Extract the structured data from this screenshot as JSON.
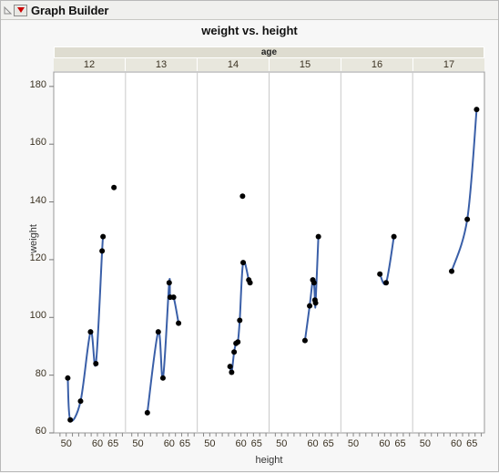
{
  "window": {
    "title": "Graph Builder",
    "disclosure_icon": "triangle-collapse-icon",
    "menu_icon": "red-triangle-menu-icon"
  },
  "chart_data": {
    "type": "scatter",
    "title": "weight vs. height",
    "xlabel": "height",
    "ylabel": "weight",
    "xlim": [
      46,
      69
    ],
    "ylim": [
      60,
      185
    ],
    "ytick_values": [
      60,
      80,
      100,
      120,
      140,
      160,
      180
    ],
    "xtick_values": [
      50,
      60,
      65
    ],
    "xtick_labels": [
      "50",
      "60",
      "65"
    ],
    "grid": false,
    "legend": "none",
    "facet_title": "age",
    "facet_values": [
      "12",
      "13",
      "14",
      "15",
      "16",
      "17"
    ],
    "point_color": "#000000",
    "line_color": "#3a5fa8",
    "panels": [
      {
        "facet": "12",
        "points": [
          {
            "x": 50.5,
            "y": 79
          },
          {
            "x": 51.3,
            "y": 64.5
          },
          {
            "x": 54.6,
            "y": 71
          },
          {
            "x": 57.8,
            "y": 95
          },
          {
            "x": 59.5,
            "y": 84
          },
          {
            "x": 61.5,
            "y": 123
          },
          {
            "x": 61.8,
            "y": 128
          },
          {
            "x": 65.3,
            "y": 145
          }
        ],
        "fit": "spline"
      },
      {
        "facet": "13",
        "points": [
          {
            "x": 53.0,
            "y": 67
          },
          {
            "x": 56.5,
            "y": 95
          },
          {
            "x": 58.0,
            "y": 79
          },
          {
            "x": 60.0,
            "y": 112
          },
          {
            "x": 60.3,
            "y": 107
          },
          {
            "x": 61.4,
            "y": 107
          },
          {
            "x": 63.0,
            "y": 98
          }
        ],
        "fit": "spline"
      },
      {
        "facet": "14",
        "points": [
          {
            "x": 56.5,
            "y": 83
          },
          {
            "x": 57.0,
            "y": 81
          },
          {
            "x": 57.8,
            "y": 88
          },
          {
            "x": 58.4,
            "y": 91
          },
          {
            "x": 59.0,
            "y": 91.5
          },
          {
            "x": 59.6,
            "y": 99
          },
          {
            "x": 60.7,
            "y": 119
          },
          {
            "x": 60.5,
            "y": 142
          },
          {
            "x": 62.5,
            "y": 113
          },
          {
            "x": 62.9,
            "y": 112
          }
        ],
        "fit": "spline"
      },
      {
        "facet": "15",
        "points": [
          {
            "x": 57.5,
            "y": 92
          },
          {
            "x": 59.0,
            "y": 104
          },
          {
            "x": 60.0,
            "y": 113
          },
          {
            "x": 60.4,
            "y": 112
          },
          {
            "x": 60.7,
            "y": 106
          },
          {
            "x": 60.9,
            "y": 105
          },
          {
            "x": 61.8,
            "y": 128
          }
        ],
        "fit": "spline"
      },
      {
        "facet": "16",
        "points": [
          {
            "x": 58.5,
            "y": 115
          },
          {
            "x": 60.5,
            "y": 112
          },
          {
            "x": 63.0,
            "y": 128
          }
        ],
        "fit": "spline"
      },
      {
        "facet": "17",
        "points": [
          {
            "x": 58.5,
            "y": 116
          },
          {
            "x": 63.5,
            "y": 134
          },
          {
            "x": 66.5,
            "y": 172
          }
        ],
        "fit": "spline"
      }
    ]
  }
}
